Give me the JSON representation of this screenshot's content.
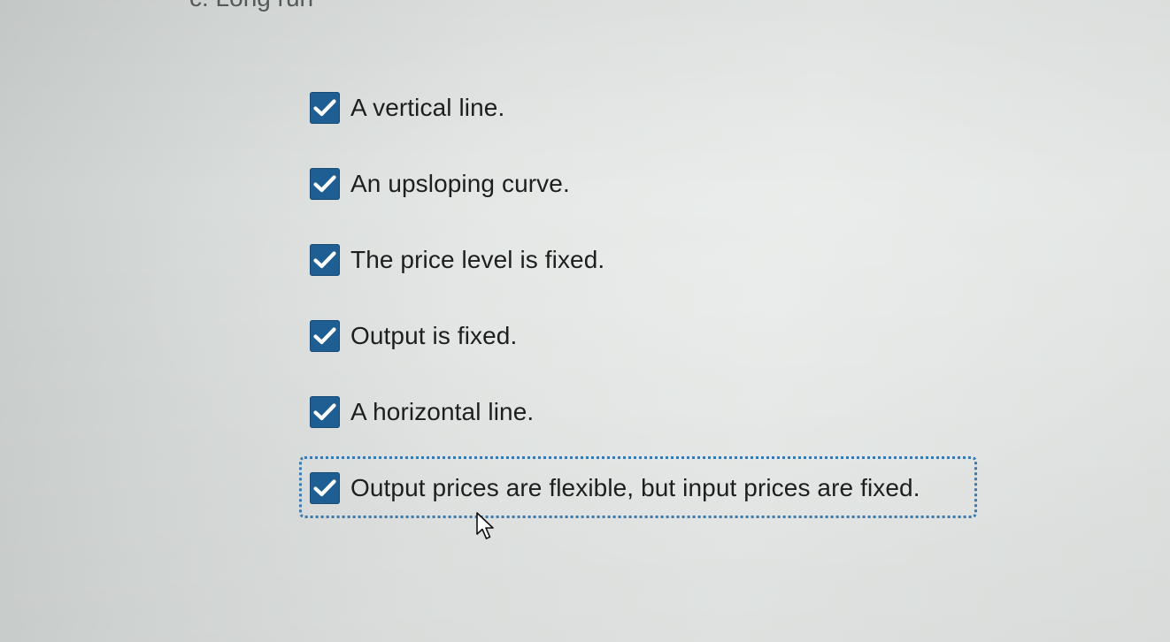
{
  "section": {
    "title": "c. Long run"
  },
  "options": [
    {
      "label": "A vertical line.",
      "checked": true
    },
    {
      "label": "An upsloping curve.",
      "checked": true
    },
    {
      "label": "The price level is fixed.",
      "checked": true
    },
    {
      "label": "Output is fixed.",
      "checked": true
    },
    {
      "label": "A horizontal line.",
      "checked": true
    },
    {
      "label": "Output prices are flexible, but input prices are fixed.",
      "checked": true,
      "focused": true
    }
  ],
  "colors": {
    "checkbox": "#1f5e93",
    "focus_ring": "#3a78b0",
    "background": "#e3e6e4"
  },
  "icons": {
    "checkmark": "checkmark-icon",
    "cursor": "mouse-pointer-icon"
  }
}
